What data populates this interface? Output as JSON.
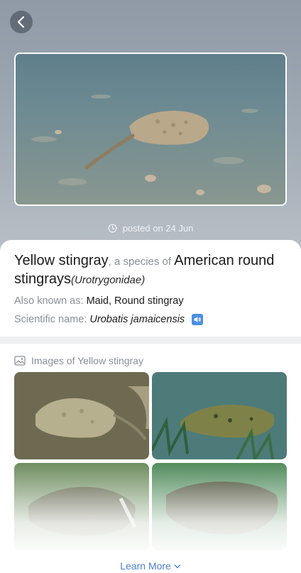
{
  "header": {
    "back_icon": "chevron-left-icon"
  },
  "post": {
    "posted_label": "posted on 24 Jun"
  },
  "species": {
    "common_name": "Yellow stingray",
    "connector": ", a species of ",
    "family_common": "American round stingrays",
    "family_scientific": "(Urotrygonidae)",
    "aka_label": "Also known as: ",
    "aka_value": "Maid, Round stingray",
    "sci_label": "Scientific name: ",
    "sci_value": "Urobatis jamaicensis"
  },
  "images": {
    "header": "Images of Yellow stingray",
    "icon": "image-icon"
  },
  "footer": {
    "learn_more": "Learn More"
  },
  "colors": {
    "accent": "#4a90e2",
    "link": "#4a7fd4"
  }
}
